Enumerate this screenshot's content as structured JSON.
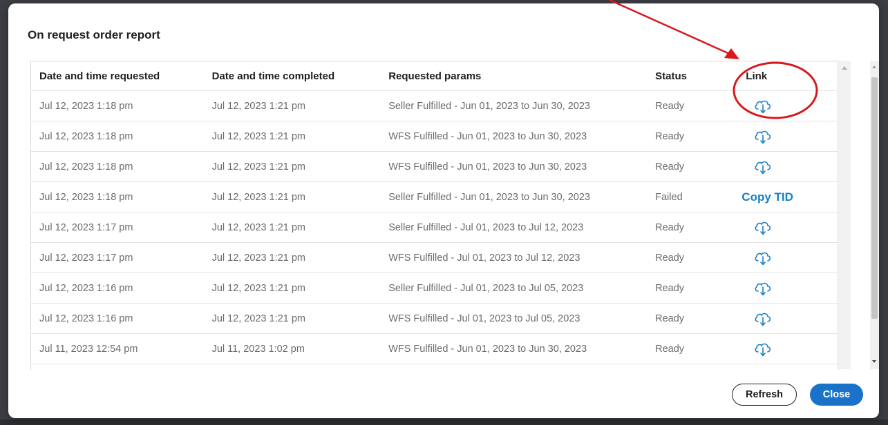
{
  "modal": {
    "title": "On request order report"
  },
  "table": {
    "headers": {
      "requested": "Date and time requested",
      "completed": "Date and time completed",
      "params": "Requested params",
      "status": "Status",
      "link": "Link"
    },
    "rows": [
      {
        "requested": "Jul 12, 2023 1:18 pm",
        "completed": "Jul 12, 2023 1:21 pm",
        "params": "Seller Fulfilled - Jun 01, 2023 to Jun 30, 2023",
        "status": "Ready",
        "link": "download-cloud-icon"
      },
      {
        "requested": "Jul 12, 2023 1:18 pm",
        "completed": "Jul 12, 2023 1:21 pm",
        "params": "WFS Fulfilled - Jun 01, 2023 to Jun 30, 2023",
        "status": "Ready",
        "link": "download-cloud-icon"
      },
      {
        "requested": "Jul 12, 2023 1:18 pm",
        "completed": "Jul 12, 2023 1:21 pm",
        "params": "WFS Fulfilled - Jun 01, 2023 to Jun 30, 2023",
        "status": "Ready",
        "link": "download-cloud-icon"
      },
      {
        "requested": "Jul 12, 2023 1:18 pm",
        "completed": "Jul 12, 2023 1:21 pm",
        "params": "Seller Fulfilled - Jun 01, 2023 to Jun 30, 2023",
        "status": "Failed",
        "link_text": "Copy TID"
      },
      {
        "requested": "Jul 12, 2023 1:17 pm",
        "completed": "Jul 12, 2023 1:21 pm",
        "params": "Seller Fulfilled - Jul 01, 2023 to Jul 12, 2023",
        "status": "Ready",
        "link": "download-cloud-icon"
      },
      {
        "requested": "Jul 12, 2023 1:17 pm",
        "completed": "Jul 12, 2023 1:21 pm",
        "params": "WFS Fulfilled - Jul 01, 2023 to Jul 12, 2023",
        "status": "Ready",
        "link": "download-cloud-icon"
      },
      {
        "requested": "Jul 12, 2023 1:16 pm",
        "completed": "Jul 12, 2023 1:21 pm",
        "params": "Seller Fulfilled - Jul 01, 2023 to Jul 05, 2023",
        "status": "Ready",
        "link": "download-cloud-icon"
      },
      {
        "requested": "Jul 12, 2023 1:16 pm",
        "completed": "Jul 12, 2023 1:21 pm",
        "params": "WFS Fulfilled - Jul 01, 2023 to Jul 05, 2023",
        "status": "Ready",
        "link": "download-cloud-icon"
      },
      {
        "requested": "Jul 11, 2023 12:54 pm",
        "completed": "Jul 11, 2023 1:02 pm",
        "params": "WFS Fulfilled - Jun 01, 2023 to Jun 30, 2023",
        "status": "Ready",
        "link": "download-cloud-icon"
      }
    ]
  },
  "buttons": {
    "refresh": "Refresh",
    "close": "Close"
  },
  "colors": {
    "accent": "#1a73c8",
    "link": "#1a7fc1",
    "annotation": "#d9181c"
  },
  "annotation": {
    "type": "red-arrow-and-circle",
    "target": "Link column header and first download icon"
  }
}
